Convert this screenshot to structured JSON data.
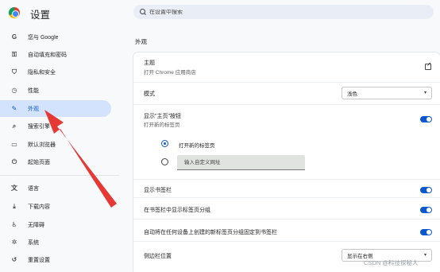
{
  "app": {
    "title": "设置",
    "logo": "chrome-logo"
  },
  "search": {
    "placeholder": "在设置中搜索"
  },
  "sidebar": {
    "items": [
      {
        "label": "您与 Google",
        "icon": "G"
      },
      {
        "label": "自动填充和密码",
        "icon": "⚿"
      },
      {
        "label": "隐私和安全",
        "icon": "⛉"
      },
      {
        "label": "性能",
        "icon": "◷"
      },
      {
        "label": "外观",
        "icon": "✎"
      },
      {
        "label": "搜索引擎",
        "icon": "⌕"
      },
      {
        "label": "默认浏览器",
        "icon": "▭"
      },
      {
        "label": "起始页面",
        "icon": "⏻"
      },
      {
        "label": "语言",
        "icon": "文"
      },
      {
        "label": "下载内容",
        "icon": "⤓"
      },
      {
        "label": "无障碍",
        "icon": "♿"
      },
      {
        "label": "系统",
        "icon": "✲"
      },
      {
        "label": "重置设置",
        "icon": "↺"
      }
    ],
    "active_index": 4
  },
  "main": {
    "section_title": "外观",
    "theme": {
      "label": "主题",
      "sub": "打开 Chrome 应用商店"
    },
    "mode": {
      "label": "模式",
      "value": "浅色"
    },
    "home_button": {
      "label": "显示\"主页\"按钮",
      "sub": "打开新的标签页",
      "enabled": true,
      "options": [
        {
          "label": "打开新的标签页",
          "selected": true
        },
        {
          "label": "",
          "selected": false
        }
      ],
      "url_placeholder": "输入自定义网址"
    },
    "bookmarks_bar": {
      "label": "显示书签栏",
      "enabled": true
    },
    "tab_groups": {
      "label": "在书签栏中显示标签页分组",
      "enabled": true
    },
    "auto_pin_groups": {
      "label": "自动将在任何设备上创建的新标签页分组固定到书签栏",
      "enabled": true
    },
    "side_panel": {
      "label": "侧边栏位置",
      "value": "显示在右侧"
    }
  },
  "watermark": "CSDN @科技探秘人",
  "colors": {
    "accent": "#0b57d0",
    "active_bg": "#d3e3fd",
    "arrow": "#e53935"
  }
}
